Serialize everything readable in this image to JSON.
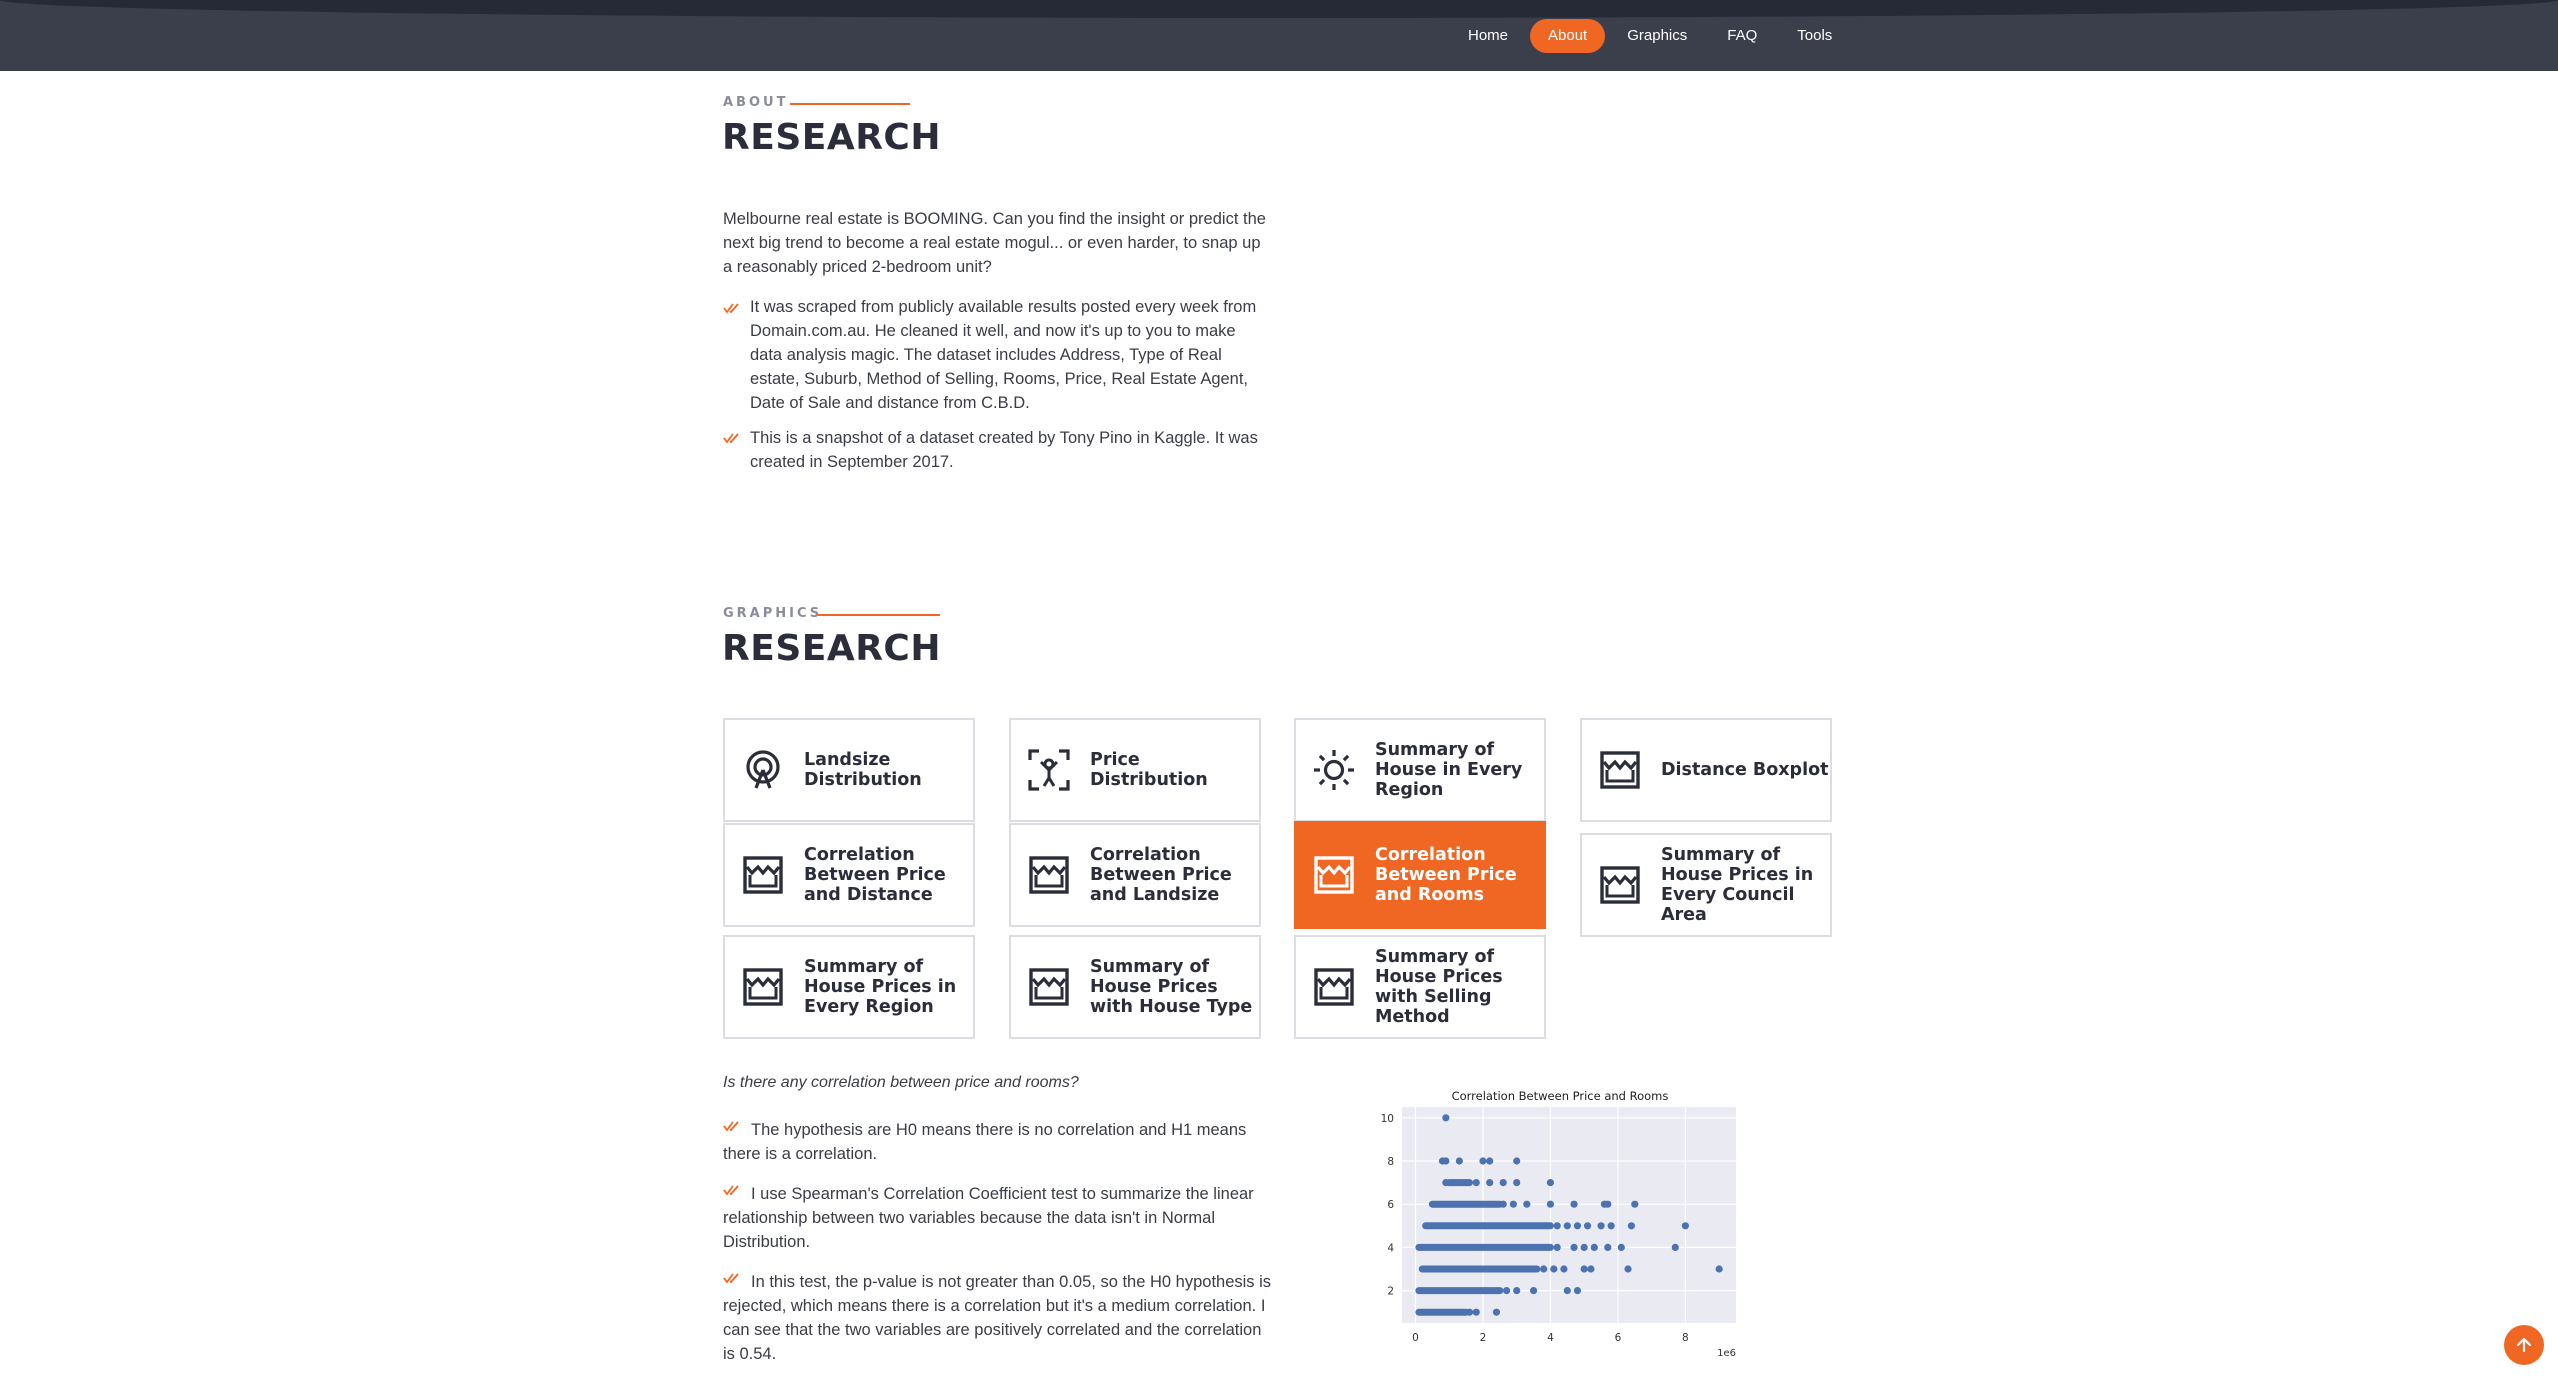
{
  "nav": {
    "items": [
      {
        "label": "Home",
        "active": false
      },
      {
        "label": "About",
        "active": true
      },
      {
        "label": "Graphics",
        "active": false
      },
      {
        "label": "FAQ",
        "active": false
      },
      {
        "label": "Tools",
        "active": false
      }
    ]
  },
  "about": {
    "eyebrow": "ABOUT",
    "title": "RESEARCH",
    "intro": "Melbourne real estate is BOOMING. Can you find the insight or predict the next big trend to become a real estate mogul... or even harder, to snap up a reasonably priced 2-bedroom unit?",
    "bullets": [
      "It was scraped from publicly available results posted every week from Domain.com.au. He cleaned it well, and now it's up to you to make data analysis magic. The dataset includes Address, Type of Real estate, Suburb, Method of Selling, Rooms, Price, Real Estate Agent, Date of Sale and distance from C.B.D.",
      "This is a snapshot of a dataset created by Tony Pino in Kaggle. It was created in September 2017."
    ]
  },
  "graphics": {
    "eyebrow": "GRAPHICS",
    "title": "RESEARCH",
    "cards": [
      {
        "label": "Landsize Distribution",
        "icon": "podcast-icon"
      },
      {
        "label": "Price Distribution",
        "icon": "focus-person-icon"
      },
      {
        "label": "Summary of House in Every Region",
        "icon": "sun-icon"
      },
      {
        "label": "Distance Boxplot",
        "icon": "store-icon"
      },
      {
        "label": "Correlation Between Price and Distance",
        "icon": "store-icon"
      },
      {
        "label": "Correlation Between Price and Landsize",
        "icon": "store-icon"
      },
      {
        "label": "Correlation Between Price and Rooms",
        "icon": "store-icon",
        "active": true
      },
      {
        "label": "Summary of House Prices in Every Council Area",
        "icon": "store-icon"
      },
      {
        "label": "Summary of House Prices in Every Region",
        "icon": "store-icon"
      },
      {
        "label": "Summary of House Prices with House Type",
        "icon": "store-icon"
      },
      {
        "label": "Summary of House Prices with Selling Method",
        "icon": "store-icon"
      }
    ]
  },
  "analysis": {
    "question": "Is there any correlation between price and rooms?",
    "points": [
      "The hypothesis are H0 means there is no correlation and H1 means there is a correlation.",
      "I use Spearman's Correlation Coefficient test to summarize the linear relationship between two variables because the data isn't in Normal Distribution.",
      "In this test, the p-value is not greater than 0.05, so the H0 hypothesis is rejected, which means there is a correlation but it's a medium correlation. I can see that the two variables are positively correlated and the correlation is 0.54."
    ]
  },
  "colors": {
    "accent": "#f06724",
    "nav_bg": "#3b3f4c",
    "point": "#4c72b0",
    "plot_bg": "#eaeaf2"
  },
  "chart_data": {
    "type": "scatter",
    "title": "Correlation Between Price and Rooms",
    "xlabel": "",
    "ylabel": "",
    "x_offset_label": "1e6",
    "xlim": [
      -0.4,
      9.5
    ],
    "ylim": [
      0.5,
      10.5
    ],
    "xticks": [
      0,
      2,
      4,
      6,
      8
    ],
    "yticks": [
      2,
      4,
      6,
      8,
      10
    ],
    "grid": true,
    "segments": [
      {
        "y": 1,
        "x_start": 0.1,
        "x_end": 1.5
      },
      {
        "y": 2,
        "x_start": 0.1,
        "x_end": 2.5
      },
      {
        "y": 3,
        "x_start": 0.2,
        "x_end": 3.6
      },
      {
        "y": 4,
        "x_start": 0.1,
        "x_end": 4.0
      },
      {
        "y": 5,
        "x_start": 0.3,
        "x_end": 4.0
      },
      {
        "y": 6,
        "x_start": 0.5,
        "x_end": 2.5
      },
      {
        "y": 7,
        "x_start": 1.0,
        "x_end": 1.6
      }
    ],
    "points": [
      [
        1.6,
        1
      ],
      [
        1.8,
        1
      ],
      [
        2.4,
        1
      ],
      [
        2.7,
        2
      ],
      [
        3.0,
        2
      ],
      [
        3.5,
        2
      ],
      [
        4.5,
        2
      ],
      [
        4.8,
        2
      ],
      [
        3.8,
        3
      ],
      [
        4.1,
        3
      ],
      [
        4.4,
        3
      ],
      [
        5.0,
        3
      ],
      [
        5.2,
        3
      ],
      [
        6.3,
        3
      ],
      [
        9.0,
        3
      ],
      [
        4.2,
        4
      ],
      [
        4.7,
        4
      ],
      [
        5.0,
        4
      ],
      [
        5.3,
        4
      ],
      [
        5.7,
        4
      ],
      [
        6.1,
        4
      ],
      [
        7.7,
        4
      ],
      [
        4.2,
        5
      ],
      [
        4.5,
        5
      ],
      [
        4.8,
        5
      ],
      [
        5.1,
        5
      ],
      [
        5.5,
        5
      ],
      [
        5.8,
        5
      ],
      [
        6.4,
        5
      ],
      [
        8.0,
        5
      ],
      [
        2.6,
        6
      ],
      [
        2.9,
        6
      ],
      [
        3.3,
        6
      ],
      [
        4.0,
        6
      ],
      [
        4.7,
        6
      ],
      [
        5.6,
        6
      ],
      [
        5.7,
        6
      ],
      [
        6.5,
        6
      ],
      [
        0.9,
        7
      ],
      [
        1.8,
        7
      ],
      [
        2.2,
        7
      ],
      [
        2.6,
        7
      ],
      [
        3.0,
        7
      ],
      [
        4.0,
        7
      ],
      [
        0.8,
        8
      ],
      [
        0.9,
        8
      ],
      [
        1.3,
        8
      ],
      [
        2.0,
        8
      ],
      [
        2.2,
        8
      ],
      [
        3.0,
        8
      ],
      [
        0.9,
        10
      ]
    ]
  }
}
